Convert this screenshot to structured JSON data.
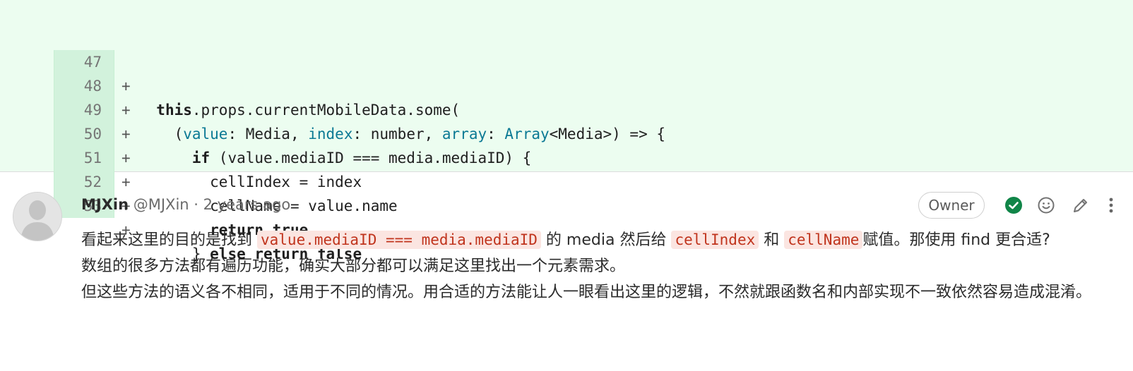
{
  "diff": {
    "lines": [
      {
        "num": "47",
        "sign": "+"
      },
      {
        "num": "48",
        "sign": "+"
      },
      {
        "num": "49",
        "sign": "+"
      },
      {
        "num": "50",
        "sign": "+"
      },
      {
        "num": "51",
        "sign": "+"
      },
      {
        "num": "52",
        "sign": "+"
      },
      {
        "num": "53",
        "sign": "+"
      }
    ],
    "code": {
      "l47": {
        "indent": "  ",
        "kw": "this",
        "rest": ".props.currentMobileData.some("
      },
      "l48": {
        "indent": "    ",
        "open": "(",
        "p1": "value",
        "p1t": ": Media, ",
        "p2": "index",
        "p2t": ": number, ",
        "p3": "array",
        "p3t": ": ",
        "arr": "Array",
        "tail": "<Media>) => {"
      },
      "l49": {
        "indent": "      ",
        "kw": "if",
        "rest": " (value.mediaID === media.mediaID) {"
      },
      "l50": {
        "indent": "        ",
        "text": "cellIndex = index"
      },
      "l51": {
        "indent": "        ",
        "text": "cellName = value.name"
      },
      "l52": {
        "indent": "        ",
        "kw": "return true"
      },
      "l53": {
        "indent": "      ",
        "brace": "} ",
        "kw": "else return false"
      }
    }
  },
  "comment": {
    "author": "MJXin",
    "handle": "@MJXin",
    "separator": " · ",
    "time": "2 years ago",
    "badge": "Owner",
    "line1_a": "看起来这里的目的是找到 ",
    "code1": "value.mediaID === media.mediaID",
    "line1_b": " 的 media 然后给 ",
    "code2": "cellIndex",
    "line1_c": " 和 ",
    "code3": "cellName",
    "line1_d": "赋值。那使用 find 更合适?",
    "line2": "数组的很多方法都有遍历功能，确实大部分都可以满足这里找出一个元素需求。",
    "line3": "但这些方法的语义各不相同，适用于不同的情况。用合适的方法能让人一眼看出这里的逻辑，不然就跟函数名和内部实现不一致依然容易造成混淆。"
  },
  "colors": {
    "diff_bg": "#ecfdf0",
    "gutter_bg": "#d2f2dc",
    "type_color": "#0b7994",
    "inline_code_color": "#c0341d",
    "inline_code_bg": "#fbe5e1",
    "resolved_green": "#108548"
  },
  "icons": [
    "check-circle-icon",
    "smiley-icon",
    "pencil-icon",
    "vertical-ellipsis-icon"
  ]
}
